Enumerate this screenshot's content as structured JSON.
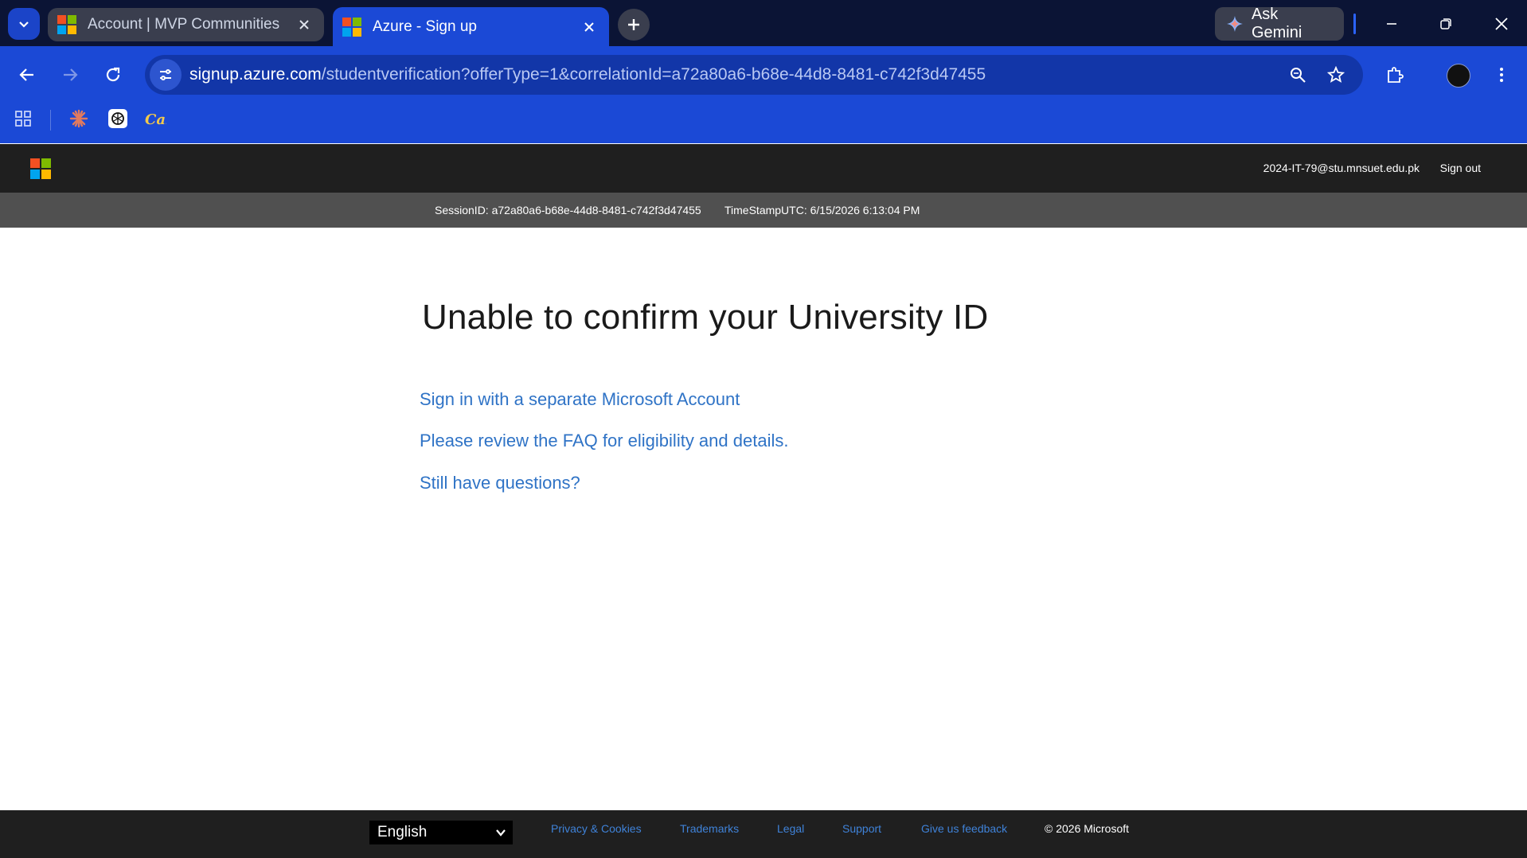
{
  "browser": {
    "tabs": [
      {
        "title": "Account | MVP Communities",
        "active": false
      },
      {
        "title": "Azure - Sign up",
        "active": true
      }
    ],
    "gemini_label": "Ask Gemini",
    "url_host": "signup.azure.com",
    "url_path": "/studentverification?offerType=1&correlationId=a72a80a6-b68e-44d8-8481-c742f3d47455",
    "bookmarks": [
      "apps-icon",
      "claude-icon",
      "chatgpt-icon",
      "cal-icon"
    ]
  },
  "header": {
    "email": "2024-IT-79@stu.mnsuet.edu.pk",
    "signout": "Sign out"
  },
  "session": {
    "id": "SessionID: a72a80a6-b68e-44d8-8481-c742f3d47455",
    "timestamp": "TimeStampUTC: 6/15/2026 6:13:04 PM"
  },
  "main": {
    "title": "Unable to confirm your University ID",
    "links": [
      "Sign in with a separate Microsoft Account",
      "Please review the FAQ for eligibility and details.",
      "Still have questions?"
    ]
  },
  "footer": {
    "language": "English",
    "links": [
      "Privacy & Cookies",
      "Trademarks",
      "Legal",
      "Support",
      "Give us feedback"
    ],
    "copyright": "© 2026 Microsoft"
  },
  "colors": {
    "chrome_dark": "#0b1435",
    "chrome_blue": "#1b49d6",
    "link": "#2f73c6",
    "footer_link": "#3f82d8"
  }
}
